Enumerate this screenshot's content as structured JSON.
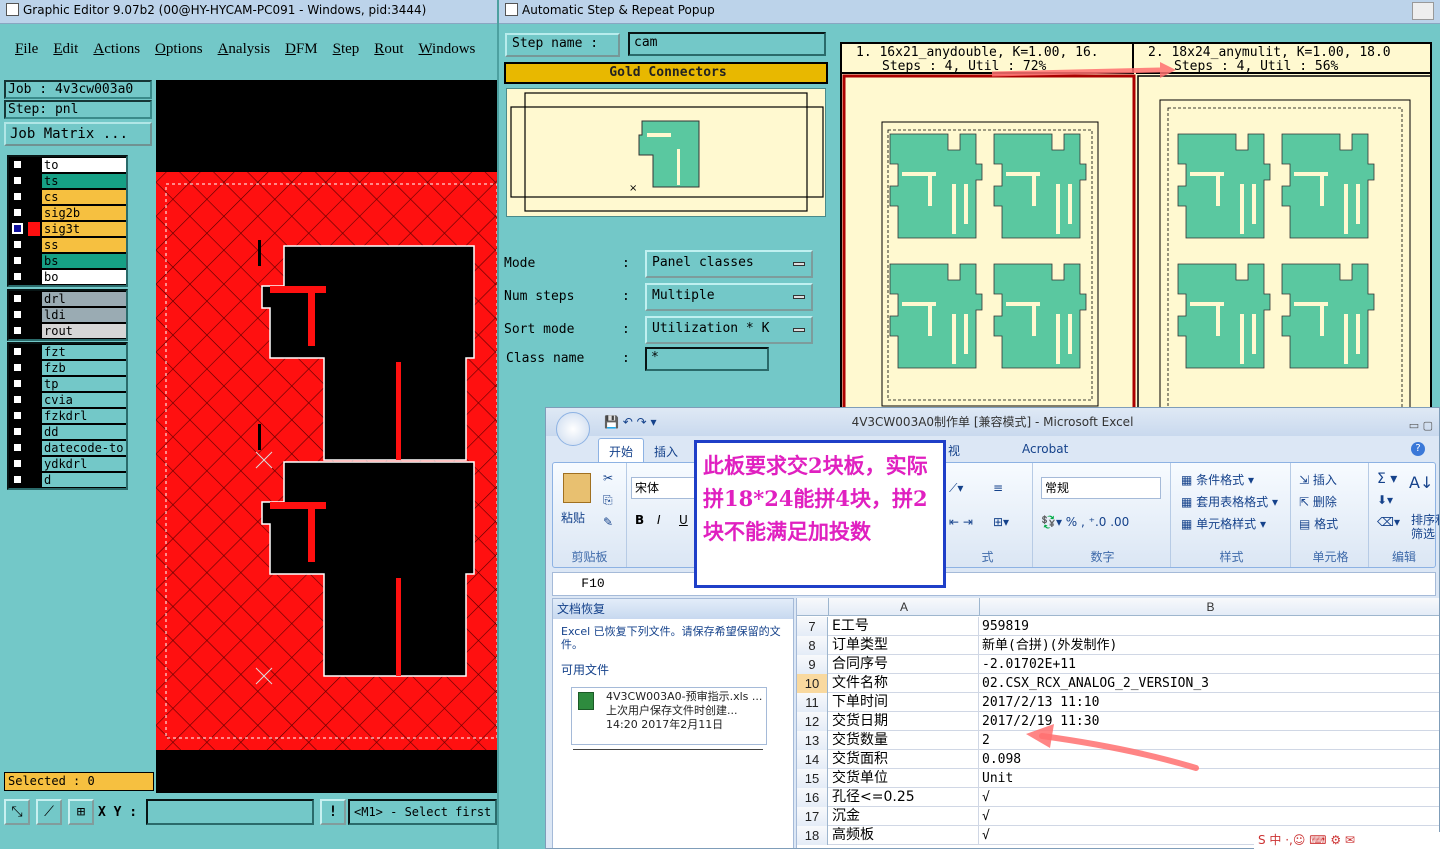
{
  "graphic_editor": {
    "title": "Graphic Editor 9.07b2 (00@HY-HYCAM-PC091 - Windows, pid:3444)",
    "menu": [
      "File",
      "Edit",
      "Actions",
      "Options",
      "Analysis",
      "DFM",
      "Step",
      "Rout",
      "Windows"
    ],
    "job": "Job : 4v3cw003a0",
    "step": "Step: pnl",
    "job_matrix": "Job Matrix ...",
    "layers_group1": [
      {
        "name": "to",
        "color": "#ffffff",
        "checked": false
      },
      {
        "name": "ts",
        "color": "#16a085",
        "checked": false
      },
      {
        "name": "cs",
        "color": "#f6c040",
        "checked": false
      },
      {
        "name": "sig2b",
        "color": "#f6c040",
        "checked": false
      },
      {
        "name": "sig3t",
        "color": "#f6c040",
        "checked": true,
        "active": true
      },
      {
        "name": "ss",
        "color": "#f6c040",
        "checked": false
      },
      {
        "name": "bs",
        "color": "#16a085",
        "checked": false
      },
      {
        "name": "bo",
        "color": "#ffffff",
        "checked": false
      }
    ],
    "layers_group2": [
      {
        "name": "drl",
        "color": "#9aabb3"
      },
      {
        "name": "ldi",
        "color": "#9aabb3"
      },
      {
        "name": "rout",
        "color": "#d6d6d6"
      }
    ],
    "layers_group3": [
      "fzt",
      "fzb",
      "tp",
      "cvia",
      "fzkdrl",
      "dd",
      "datecode-to",
      "ydkdrl",
      "d"
    ],
    "selected": "Selected : 0",
    "xy_label": "X Y :",
    "status_msg": "<M1> - Select first c"
  },
  "popup": {
    "title": "Automatic Step & Repeat Popup",
    "step_name_label": "Step name :",
    "step_name_value": "cam",
    "gold_connectors": "Gold Connectors",
    "rows": [
      {
        "label": "Mode",
        "colon": ":",
        "value": "Panel classes"
      },
      {
        "label": "Num steps",
        "colon": ":",
        "value": "Multiple"
      },
      {
        "label": "Sort mode",
        "colon": ":",
        "value": "Utilization * K"
      }
    ],
    "class_name_label": "Class name",
    "class_name_colon": ":",
    "class_name_value": "*",
    "result1_line1": "1. 16x21_anydouble, K=1.00, 16.",
    "result1_line2": "Steps : 4, Util : 72%",
    "result2_line1": "2. 18x24_anymulit, K=1.00, 18.0",
    "result2_line2": "Steps : 4, Util : 56%"
  },
  "excel": {
    "title": "4V3CW003A0制作单 [兼容模式] - Microsoft Excel",
    "tabs": [
      "开始",
      "插入",
      "视图",
      "Acrobat"
    ],
    "clipboard": {
      "paste": "粘贴",
      "group": "剪贴板"
    },
    "font_name": "宋体",
    "number_format": "常规",
    "group_number": "数字",
    "styles": [
      "条件格式",
      "套用表格格式",
      "单元格样式"
    ],
    "group_styles": "样式",
    "cells_btns": [
      "插入",
      "删除",
      "格式"
    ],
    "group_cells": "单元格",
    "editing": [
      "排序和",
      "筛选"
    ],
    "group_editing": "编辑",
    "group_align_partial": "式",
    "cell_ref": "F10",
    "recovery": {
      "title": "文档恢复",
      "desc": "Excel 已恢复下列文件。请保存希望保留的文件。",
      "available": "可用文件",
      "file_name": "4V3CW003A0-预审指示.xls ...",
      "file_desc": "上次用户保存文件时创建...",
      "file_time": "14:20 2017年2月11日"
    },
    "columns": [
      "A",
      "B"
    ],
    "rows": [
      {
        "n": "7",
        "a": "E工号",
        "b": "959819"
      },
      {
        "n": "8",
        "a": "订单类型",
        "b": "新单(合拼)(外发制作)"
      },
      {
        "n": "9",
        "a": "合同序号",
        "b": "-2.01702E+11"
      },
      {
        "n": "10",
        "a": "文件名称",
        "b": "02.CSX_RCX_ANALOG_2_VERSION_3",
        "sel": true
      },
      {
        "n": "11",
        "a": "下单时间",
        "b": "2017/2/13 11:10"
      },
      {
        "n": "12",
        "a": "交货日期",
        "b": "2017/2/19 11:30"
      },
      {
        "n": "13",
        "a": "交货数量",
        "b": "2"
      },
      {
        "n": "14",
        "a": "交货面积",
        "b": "0.098"
      },
      {
        "n": "15",
        "a": "交货单位",
        "b": "Unit"
      },
      {
        "n": "16",
        "a": "孔径<=0.25",
        "b": "√"
      },
      {
        "n": "17",
        "a": "沉金",
        "b": "√"
      },
      {
        "n": "18",
        "a": "高频板",
        "b": "√"
      }
    ]
  },
  "annotation": "此板要求交2块板，实际拼18*24能拼4块，拼2块不能满足加投数",
  "colors": {
    "teal": "#73c8c8",
    "panel_green": "#5ac8a0",
    "copper_red": "#ff1010",
    "annotation_pink": "#e020c0",
    "arrow": "#ff7070"
  }
}
